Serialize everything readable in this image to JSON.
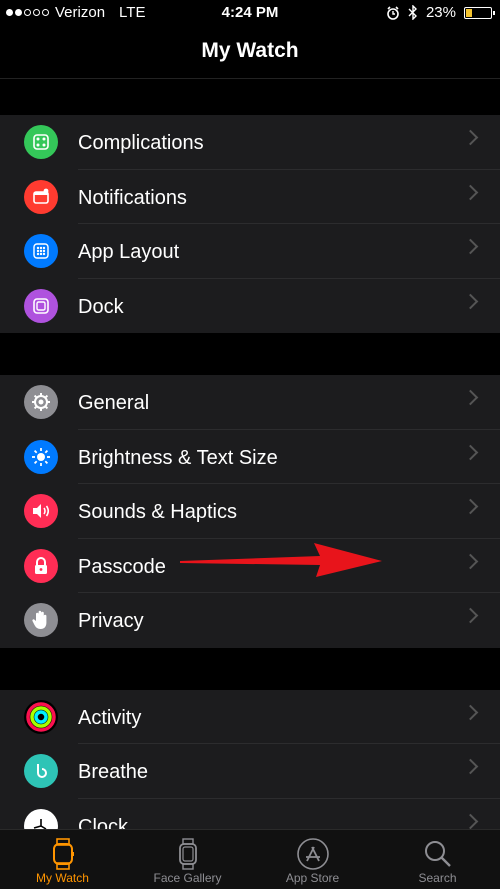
{
  "status": {
    "carrier": "Verizon",
    "network": "LTE",
    "time": "4:24 PM",
    "battery": "23%",
    "battery_level": 0.23
  },
  "nav": {
    "title": "My Watch"
  },
  "groups": [
    {
      "items": [
        {
          "label": "Complications",
          "icon": "complications-icon",
          "color": "#34c759"
        },
        {
          "label": "Notifications",
          "icon": "notifications-icon",
          "color": "#ff3b30"
        },
        {
          "label": "App Layout",
          "icon": "app-layout-icon",
          "color": "#007aff"
        },
        {
          "label": "Dock",
          "icon": "dock-icon",
          "color": "#af52de"
        }
      ]
    },
    {
      "items": [
        {
          "label": "General",
          "icon": "gear-icon",
          "color": "#8e8e93"
        },
        {
          "label": "Brightness & Text Size",
          "icon": "brightness-icon",
          "color": "#007aff"
        },
        {
          "label": "Sounds & Haptics",
          "icon": "speaker-icon",
          "color": "#ff2d55"
        },
        {
          "label": "Passcode",
          "icon": "lock-icon",
          "color": "#ff2d55"
        },
        {
          "label": "Privacy",
          "icon": "hand-icon",
          "color": "#8e8e93"
        }
      ]
    },
    {
      "items": [
        {
          "label": "Activity",
          "icon": "activity-rings-icon",
          "color": "#000000"
        },
        {
          "label": "Breathe",
          "icon": "breathe-icon",
          "color": "#2ec4b6"
        },
        {
          "label": "Clock",
          "icon": "clock-icon",
          "color": "#ffffff"
        }
      ]
    }
  ],
  "tabs": [
    {
      "label": "My Watch",
      "icon": "watch-icon",
      "active": true
    },
    {
      "label": "Face Gallery",
      "icon": "face-gallery-icon",
      "active": false
    },
    {
      "label": "App Store",
      "icon": "app-store-icon",
      "active": false
    },
    {
      "label": "Search",
      "icon": "search-icon",
      "active": false
    }
  ],
  "accent": "#ff9500"
}
